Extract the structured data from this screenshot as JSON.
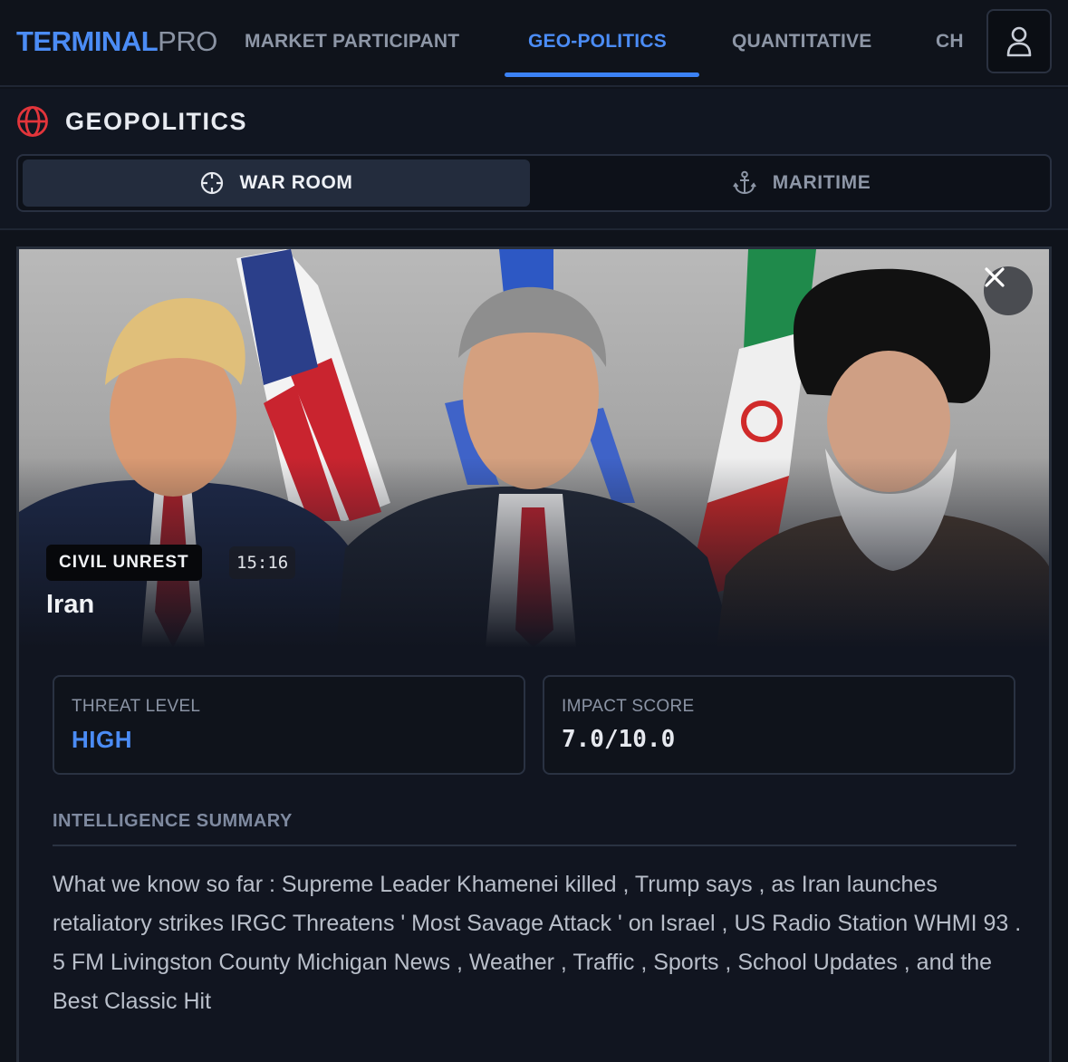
{
  "brand": {
    "part1": "TERMINAL",
    "part2": "PRO"
  },
  "nav": {
    "tabs": [
      {
        "label": "MARKET PARTICIPANT",
        "active": false
      },
      {
        "label": "GEO-POLITICS",
        "active": true
      },
      {
        "label": "QUANTITATIVE",
        "active": false
      },
      {
        "label": "CH",
        "active": false
      }
    ]
  },
  "section": {
    "title": "GEOPOLITICS",
    "subtabs": [
      {
        "label": "WAR ROOM",
        "icon": "crosshair-icon",
        "active": true
      },
      {
        "label": "MARITIME",
        "icon": "anchor-icon",
        "active": false
      }
    ]
  },
  "card": {
    "tag": "CIVIL UNREST",
    "time": "15:16",
    "location": "Iran",
    "threat": {
      "label": "THREAT LEVEL",
      "value": "HIGH"
    },
    "impact": {
      "label": "IMPACT SCORE",
      "value": "7.0/10.0"
    },
    "summary_heading": "INTELLIGENCE SUMMARY",
    "summary": "What we know so far : Supreme Leader Khamenei killed , Trump says , as Iran launches retaliatory strikes IRGC Threatens ' Most Savage Attack ' on Israel , US Radio Station WHMI 93 . 5 FM Livingston County Michigan News , Weather , Traffic , Sports , School Updates , and the Best Classic Hit"
  },
  "colors": {
    "accent": "#4b8cf5",
    "alert_red": "#e2353b",
    "background": "#0f131b"
  }
}
